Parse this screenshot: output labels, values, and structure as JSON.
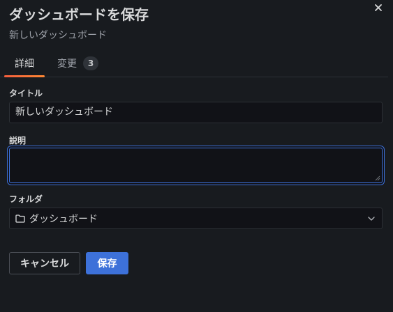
{
  "modal": {
    "title": "ダッシュボードを保存",
    "subtitle": "新しいダッシュボード",
    "close_icon": "close-icon"
  },
  "tabs": [
    {
      "label": "詳細",
      "active": true
    },
    {
      "label": "変更",
      "count": "3",
      "active": false
    }
  ],
  "form": {
    "title_label": "タイトル",
    "title_value": "新しいダッシュボード",
    "description_label": "説明",
    "description_value": "",
    "folder_label": "フォルダ",
    "folder_value": "ダッシュボード",
    "folder_icon": "folder-icon",
    "dropdown_icon": "chevron-down-icon"
  },
  "buttons": {
    "cancel_label": "キャンセル",
    "save_label": "保存"
  },
  "colors": {
    "background": "#181b1f",
    "primary": "#3d71d9",
    "tab_accent": "#ff8833"
  }
}
